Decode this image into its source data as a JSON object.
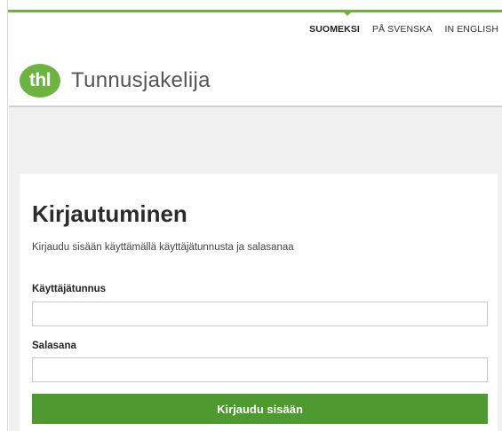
{
  "languages": {
    "fi": "SUOMEKSI",
    "sv": "PÅ SVENSKA",
    "en": "IN ENGLISH",
    "active": "fi"
  },
  "brand": {
    "logo_text": "thl",
    "title": "Tunnusjakelija"
  },
  "login": {
    "title": "Kirjautuminen",
    "description": "Kirjaudu sisään käyttämällä käyttäjätunnusta ja salasanaa",
    "username_label": "Käyttäjätunnus",
    "username_value": "",
    "password_label": "Salasana",
    "password_value": "",
    "submit_label": "Kirjaudu sisään"
  },
  "colors": {
    "brand_green": "#6cb33f",
    "button_green": "#4e9a30",
    "page_grey": "#f0f0f0"
  }
}
